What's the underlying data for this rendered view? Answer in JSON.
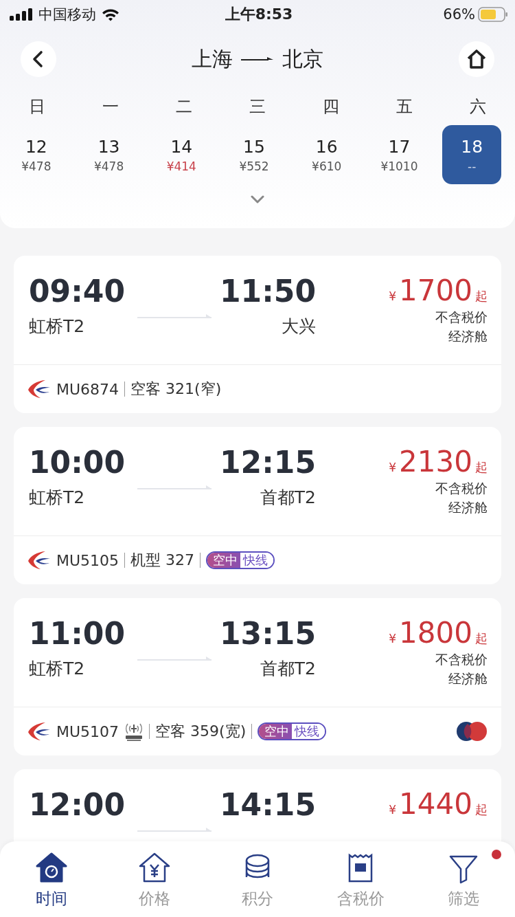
{
  "status_bar": {
    "carrier": "中国移动",
    "time": "上午8:53",
    "battery": "66%"
  },
  "route": {
    "from": "上海",
    "to": "北京"
  },
  "calendar": {
    "weekdays": [
      "日",
      "一",
      "二",
      "三",
      "四",
      "五",
      "六"
    ],
    "days": [
      {
        "date": "12",
        "price": "¥478",
        "lowest": false,
        "selected": false
      },
      {
        "date": "13",
        "price": "¥478",
        "lowest": false,
        "selected": false
      },
      {
        "date": "14",
        "price": "¥414",
        "lowest": true,
        "selected": false
      },
      {
        "date": "15",
        "price": "¥552",
        "lowest": false,
        "selected": false
      },
      {
        "date": "16",
        "price": "¥610",
        "lowest": false,
        "selected": false
      },
      {
        "date": "17",
        "price": "¥1010",
        "lowest": false,
        "selected": false
      },
      {
        "date": "18",
        "price": "--",
        "lowest": false,
        "selected": true
      }
    ]
  },
  "flights": [
    {
      "dep_time": "09:40",
      "dep_airport": "虹桥T2",
      "arr_time": "11:50",
      "arr_airport": "大兴",
      "currency": "¥",
      "price": "1700",
      "suffix": "起",
      "tax_note": "不含税价",
      "cabin": "经济舱",
      "flight_no": "MU6874",
      "wifi": false,
      "aircraft": "空客 321(窄)",
      "alliance": false
    },
    {
      "dep_time": "10:00",
      "dep_airport": "虹桥T2",
      "arr_time": "12:15",
      "arr_airport": "首都T2",
      "currency": "¥",
      "price": "2130",
      "suffix": "起",
      "tax_note": "不含税价",
      "cabin": "经济舱",
      "flight_no": "MU5105",
      "wifi": false,
      "aircraft": "机型 327",
      "badge": {
        "left": "空中",
        "right": "快线"
      },
      "alliance": false
    },
    {
      "dep_time": "11:00",
      "dep_airport": "虹桥T2",
      "arr_time": "13:15",
      "arr_airport": "首都T2",
      "currency": "¥",
      "price": "1800",
      "suffix": "起",
      "tax_note": "不含税价",
      "cabin": "经济舱",
      "flight_no": "MU5107",
      "wifi": true,
      "aircraft": "空客 359(宽)",
      "badge": {
        "left": "空中",
        "right": "快线"
      },
      "alliance": true
    },
    {
      "dep_time": "12:00",
      "arr_time": "14:15",
      "currency": "¥",
      "price": "1440",
      "suffix": "起"
    }
  ],
  "tabs": [
    {
      "label": "时间",
      "selected": true,
      "dot": false,
      "kind": "time"
    },
    {
      "label": "价格",
      "selected": false,
      "dot": false,
      "kind": "price"
    },
    {
      "label": "积分",
      "selected": false,
      "dot": false,
      "kind": "points"
    },
    {
      "label": "含税价",
      "selected": false,
      "dot": false,
      "kind": "tax"
    },
    {
      "label": "筛选",
      "selected": false,
      "dot": true,
      "kind": "filter"
    }
  ]
}
